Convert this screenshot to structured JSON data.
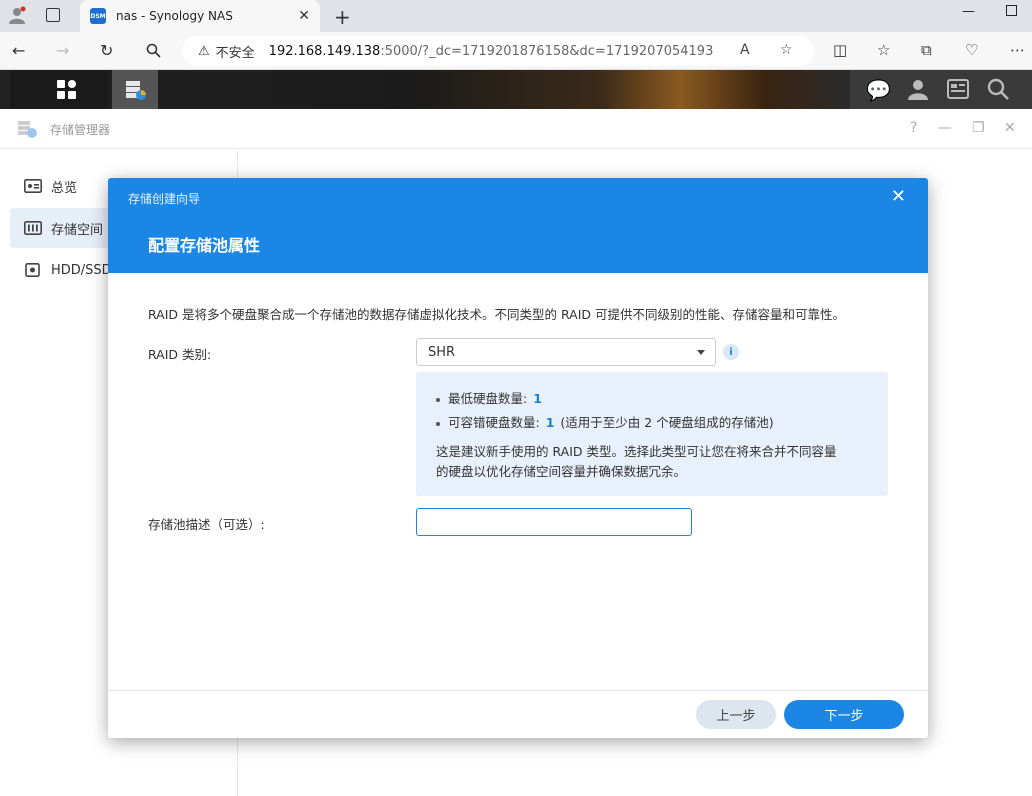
{
  "browser": {
    "tab_title": "nas - Synology NAS",
    "favicon_text": "DSM",
    "insecure_label": "不安全",
    "url_host": "192.168.149.138",
    "url_rest": ":5000/?_dc=1719201876158&dc=1719207054193"
  },
  "app": {
    "title": "存储管理器",
    "help": "?",
    "sidebar": {
      "items": [
        {
          "label": "总览",
          "icon": "overview-icon"
        },
        {
          "label": "存储空间",
          "icon": "storage-icon"
        },
        {
          "label": "HDD/SSD",
          "icon": "hdd-icon"
        }
      ]
    }
  },
  "wizard": {
    "window_title": "存储创建向导",
    "step_title": "配置存储池属性",
    "description": "RAID 是将多个硬盘聚合成一个存储池的数据存储虚拟化技术。不同类型的 RAID 可提供不同级别的性能、存储容量和可靠性。",
    "raid_label": "RAID 类别:",
    "raid_value": "SHR",
    "info": {
      "min_disks_label": "最低硬盘数量:",
      "min_disks_value": "1",
      "fault_tolerance_label": "可容错硬盘数量:",
      "fault_tolerance_value": "1",
      "fault_tolerance_note": "(适用于至少由 2 个硬盘组成的存储池)",
      "note_line1": "这是建议新手使用的 RAID 类型。选择此类型可让您在将来合并不同容量",
      "note_line2": "的硬盘以优化存储空间容量并确保数据冗余。"
    },
    "desc_label": "存储池描述（可选）:",
    "desc_value": "",
    "prev_label": "上一步",
    "next_label": "下一步"
  },
  "colors": {
    "accent": "#1b86e3",
    "info_bg": "#e8f1fb",
    "sidebar_active": "#e6eef8"
  }
}
